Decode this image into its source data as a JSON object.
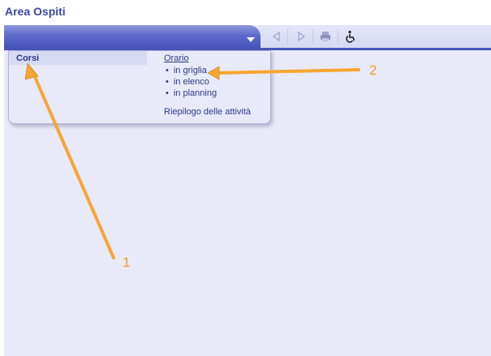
{
  "page_title": "Area Ospiti",
  "menu": {
    "corsi_label": "Corsi",
    "orario_label": "Orario",
    "orario_items": [
      "in griglia",
      "in elenco",
      "in planning"
    ],
    "riepilogo_label": "Riepilogo delle attività"
  },
  "toolbar": {
    "icons": [
      "prev-icon",
      "next-icon",
      "print-icon",
      "accessibility-icon"
    ]
  },
  "callouts": {
    "one": "1",
    "two": "2",
    "color": "#f39a1e"
  },
  "colors": {
    "accent": "#3a47a8",
    "menu_bar": "#4653b8",
    "background": "#e8eaf9"
  }
}
